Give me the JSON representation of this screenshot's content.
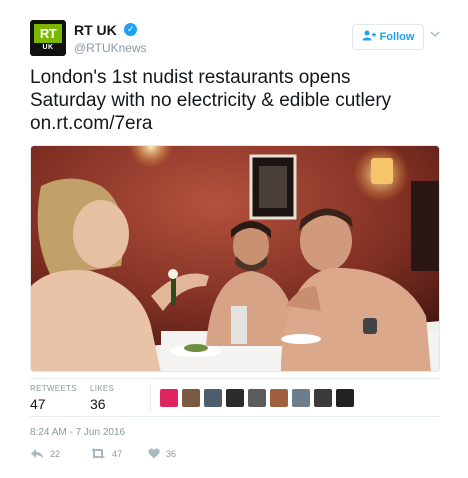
{
  "account": {
    "display_name": "RT UK",
    "handle": "@RTUKnews",
    "avatar_text": "RT",
    "avatar_subtext": "UK",
    "verified_icon": "verified-badge-icon"
  },
  "follow_button": {
    "label": "Follow",
    "icon": "user-plus-icon"
  },
  "tweet": {
    "text": "London's 1st nudist restaurants opens\nSaturday with no electricity & edible cutlery\non.rt.com/7era"
  },
  "stats": {
    "retweets_label": "RETWEETS",
    "retweets_value": "47",
    "likes_label": "LIKES",
    "likes_value": "36"
  },
  "timestamp": "8:24 AM - 7 Jun 2016",
  "actions": {
    "reply_count": "22",
    "retweet_count": "47",
    "like_count": "36"
  },
  "colors": {
    "brand": "#1da1f2",
    "rt_green": "#7ab800",
    "muted": "#8899a6"
  }
}
